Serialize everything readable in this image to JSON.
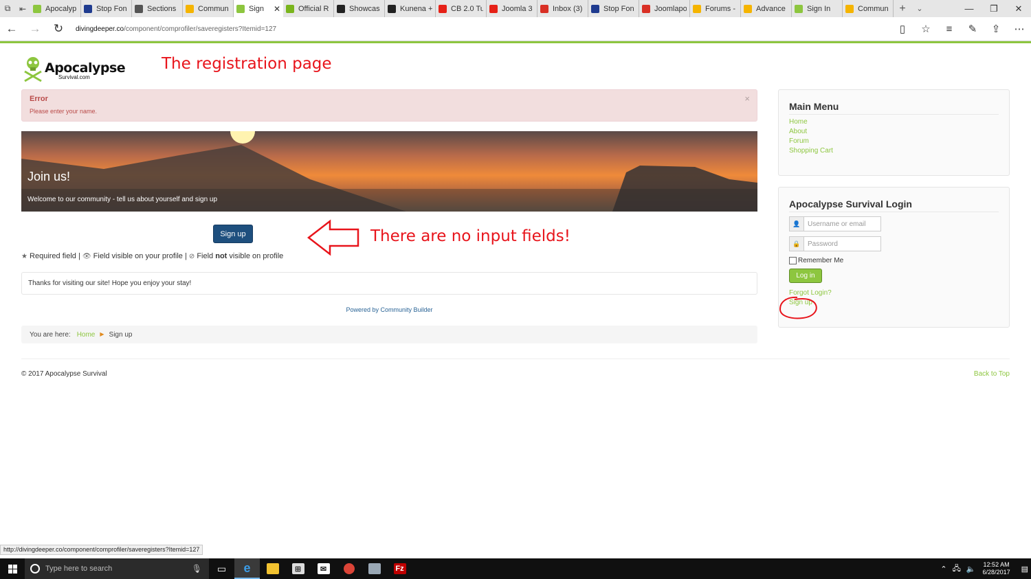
{
  "browser": {
    "tabs": [
      {
        "title": "Apocalyp",
        "color": "#8dc63f"
      },
      {
        "title": "Stop Fon",
        "color": "#1f3b8f"
      },
      {
        "title": "Sections",
        "color": "#555555"
      },
      {
        "title": "Commun",
        "color": "#f5b400"
      },
      {
        "title": "Sign",
        "color": "#8dc63f",
        "active": true
      },
      {
        "title": "Official R",
        "color": "#7ab51d"
      },
      {
        "title": "Showcas",
        "color": "#222222"
      },
      {
        "title": "Kunena +",
        "color": "#222222"
      },
      {
        "title": "CB 2.0 Tu",
        "color": "#e62117"
      },
      {
        "title": "Joomla 3",
        "color": "#e62117"
      },
      {
        "title": "Inbox (3)",
        "color": "#d93025"
      },
      {
        "title": "Stop Fon",
        "color": "#1f3b8f"
      },
      {
        "title": "Joomlapo",
        "color": "#d93025"
      },
      {
        "title": "Forums -",
        "color": "#f5b400"
      },
      {
        "title": "Advance",
        "color": "#f5b400"
      },
      {
        "title": "Sign In",
        "color": "#8dc63f"
      },
      {
        "title": "Commun",
        "color": "#f5b400"
      }
    ],
    "url_host": "divingdeeper.co",
    "url_path": "/component/comprofiler/saveregisters?Itemid=127",
    "status_url": "http://divingdeeper.co/component/comprofiler/saveregisters?Itemid=127"
  },
  "annotations": {
    "title": "The registration page",
    "no_inputs": "There are no input fields!"
  },
  "logo": {
    "main": "Apocalypse",
    "sub": "Survival.com"
  },
  "alert": {
    "heading": "Error",
    "message": "Please enter your name.",
    "close": "×"
  },
  "hero": {
    "title": "Join us!",
    "subtitle": "Welcome to our community - tell us about yourself and sign up"
  },
  "form": {
    "signup_label": "Sign up",
    "legend_required": "Required field",
    "legend_visible": "Field visible on your profile",
    "legend_field": "Field",
    "legend_not": "not",
    "legend_not_visible": "visible on profile"
  },
  "thanks": "Thanks for visiting our site! Hope you enjoy your stay!",
  "powered": "Powered by Community Builder",
  "breadcrumb": {
    "prefix": "You are here:",
    "home": "Home",
    "current": "Sign up"
  },
  "footer": {
    "copyright": "© 2017 Apocalypse Survival",
    "back_to_top": "Back to Top"
  },
  "sidebar": {
    "menu_title": "Main Menu",
    "menu_items": [
      "Home",
      "About",
      "Forum",
      "Shopping Cart"
    ],
    "login_title": "Apocalypse Survival Login",
    "username_placeholder": "Username or email",
    "password_placeholder": "Password",
    "remember_label": "Remember Me",
    "login_button": "Log in",
    "forgot_link": "Forgot Login?",
    "signup_link": "Sign up"
  },
  "taskbar": {
    "search_placeholder": "Type here to search",
    "time": "12:52 AM",
    "date": "6/28/2017"
  },
  "colors": {
    "brand_green": "#8dc63f",
    "annotation_red": "#e8141b",
    "signup_blue": "#1e4f7e"
  }
}
